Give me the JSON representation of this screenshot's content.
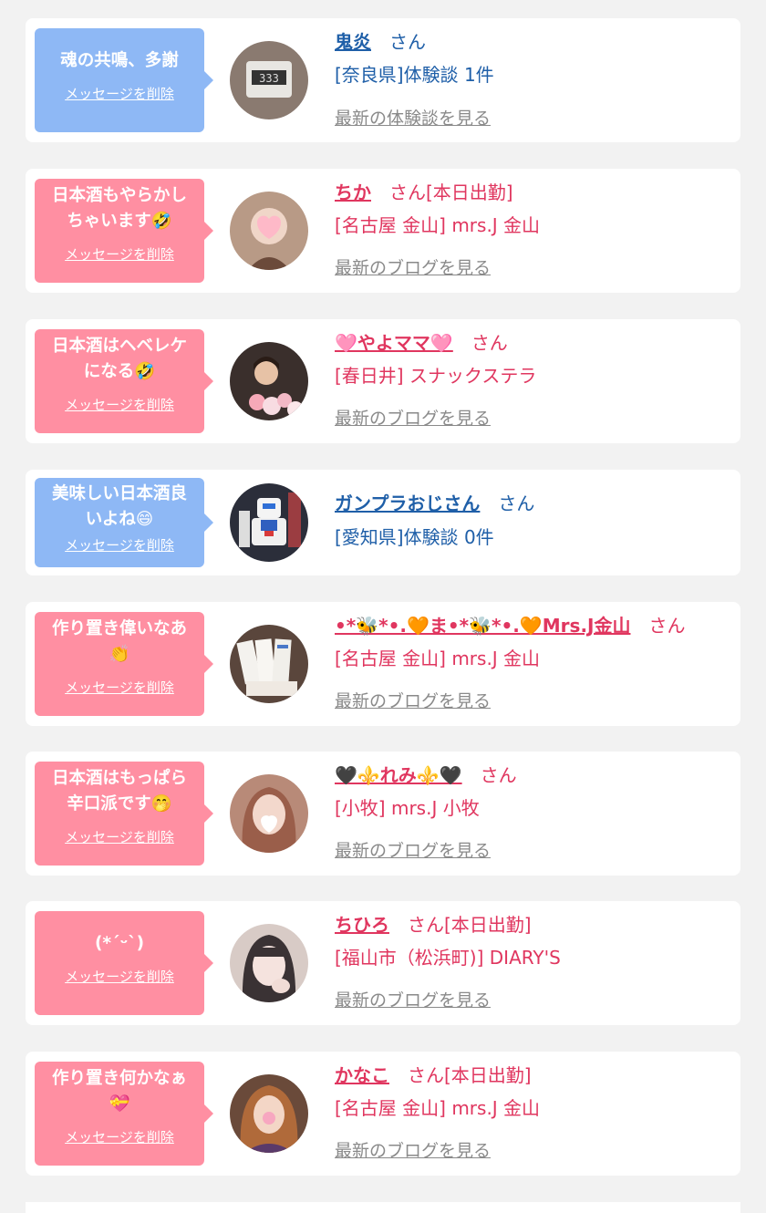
{
  "delete_label": "メッセージを削除",
  "san_label": "さん",
  "cards": [
    {
      "bubble_text": "魂の共鳴、多謝",
      "name": "鬼炎",
      "status": "",
      "info": "[奈良県]体験談 1件",
      "more": "最新の体験談を見る"
    },
    {
      "bubble_text": "日本酒もやらかし\nちゃいます🤣",
      "name": "ちか",
      "status": "[本日出勤]",
      "info": "[名古屋 金山] mrs.J 金山",
      "more": "最新のブログを見る"
    },
    {
      "bubble_text": "日本酒はヘベレケ\nになる🤣",
      "name": "🩷やよママ🩷",
      "status": "",
      "info": "[春日井] スナックステラ",
      "more": "最新のブログを見る"
    },
    {
      "bubble_text": "美味しい日本酒良\nいよね😄",
      "name": "ガンプラおじさん",
      "status": "",
      "info": "[愛知県]体験談 0件",
      "more": ""
    },
    {
      "bubble_text": "作り置き偉いなあ\n👏",
      "name": "•*🐝*•.🧡ま•*🐝*•.🧡Mrs.J金山",
      "status": "",
      "info": "[名古屋 金山] mrs.J 金山",
      "more": "最新のブログを見る"
    },
    {
      "bubble_text": "日本酒はもっぱら\n辛口派です🤭",
      "name": "🖤⚜️れみ⚜️🖤",
      "status": "",
      "info": "[小牧] mrs.J 小牧",
      "more": "最新のブログを見る"
    },
    {
      "bubble_text": "(*ˊᵕˋ)",
      "name": "ちひろ",
      "status": "[本日出勤]",
      "info": "[福山市（松浜町)] DIARY'S",
      "more": "最新のブログを見る"
    },
    {
      "bubble_text": "作り置き何かなぁ\n💝",
      "name": "かなこ",
      "status": "[本日出勤]",
      "info": "[名古屋 金山] mrs.J 金山",
      "more": "最新のブログを見る"
    }
  ]
}
